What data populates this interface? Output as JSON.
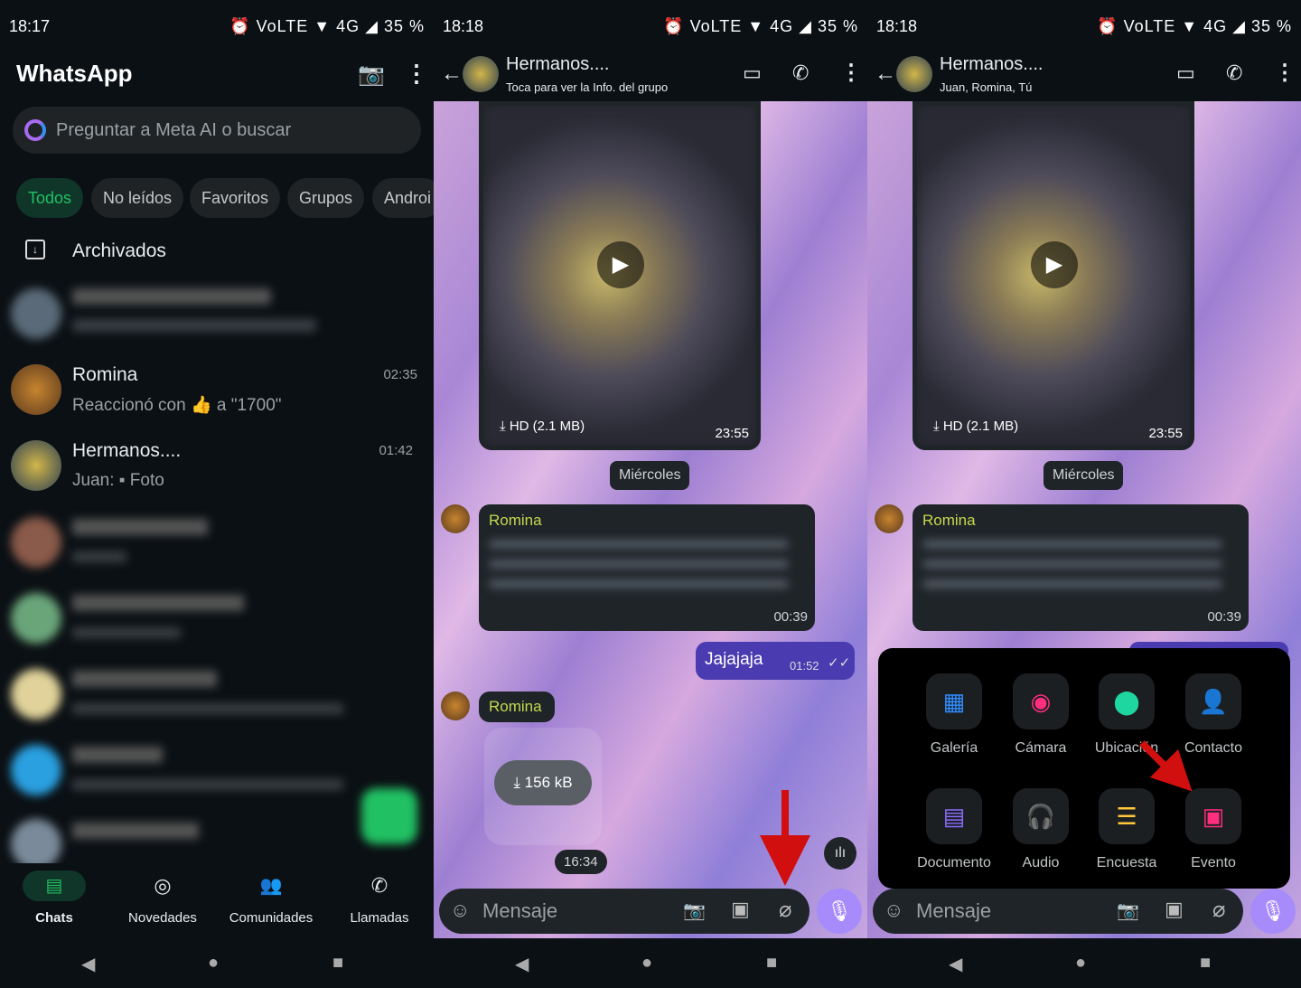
{
  "screen1": {
    "status": {
      "time": "18:17",
      "icons": "⏰ VoLTE ▼ 4G ◢",
      "battery": "35 %"
    },
    "title": "WhatsApp",
    "search_placeholder": "Preguntar a Meta AI o buscar",
    "filters": [
      "Todos",
      "No leídos",
      "Favoritos",
      "Grupos",
      "Androi"
    ],
    "archived": "Archivados",
    "chats": [
      {
        "name": "Romina",
        "time": "02:35",
        "preview": "Reaccionó con 👍 a \"1700\""
      },
      {
        "name": "Hermanos....",
        "time": "01:42",
        "preview_sender": "Juan:",
        "preview": "Foto"
      }
    ],
    "nav": [
      "Chats",
      "Novedades",
      "Comunidades",
      "Llamadas"
    ]
  },
  "screen2": {
    "status": {
      "time": "18:18",
      "icons": "⏰ VoLTE ▼ 4G ◢",
      "battery": "35 %"
    },
    "group_name": "Hermanos....",
    "subtitle": "Toca para ver la Info. del grupo",
    "video": {
      "size": "HD (2.1 MB)",
      "time": "23:55"
    },
    "day": "Miércoles",
    "msg1": {
      "sender": "Romina",
      "time": "00:39"
    },
    "outgoing": {
      "text": "Jajajaja",
      "time": "01:52"
    },
    "msg2": {
      "sender": "Romina",
      "file_size": "156 kB",
      "time": "16:34"
    },
    "input_placeholder": "Mensaje"
  },
  "screen3": {
    "status": {
      "time": "18:18",
      "icons": "⏰ VoLTE ▼ 4G ◢",
      "battery": "35 %"
    },
    "group_name": "Hermanos....",
    "subtitle": "Juan, Romina, Tú",
    "video": {
      "size": "HD (2.1 MB)",
      "time": "23:55"
    },
    "day": "Miércoles",
    "msg1": {
      "sender": "Romina",
      "time": "00:39"
    },
    "attach_menu": [
      {
        "label": "Galería",
        "icon": "gallery-icon",
        "color": "#2f8cff"
      },
      {
        "label": "Cámara",
        "icon": "camera-icon",
        "color": "#ff2e7e"
      },
      {
        "label": "Ubicación",
        "icon": "location-icon",
        "color": "#1ed7a0"
      },
      {
        "label": "Contacto",
        "icon": "contact-icon",
        "color": "#14b3f0"
      },
      {
        "label": "Documento",
        "icon": "document-icon",
        "color": "#8b6cff"
      },
      {
        "label": "Audio",
        "icon": "headphones-icon",
        "color": "#ff7a2f"
      },
      {
        "label": "Encuesta",
        "icon": "poll-icon",
        "color": "#ffc83a"
      },
      {
        "label": "Evento",
        "icon": "calendar-icon",
        "color": "#ff2e7e"
      }
    ],
    "input_placeholder": "Mensaje"
  },
  "colors": {
    "accent_green": "#21c063",
    "chip_active_bg": "#103529",
    "mic": "#a78bfa",
    "outgoing_bubble": "#4b3bb0",
    "arrow": "#d10f0f"
  }
}
